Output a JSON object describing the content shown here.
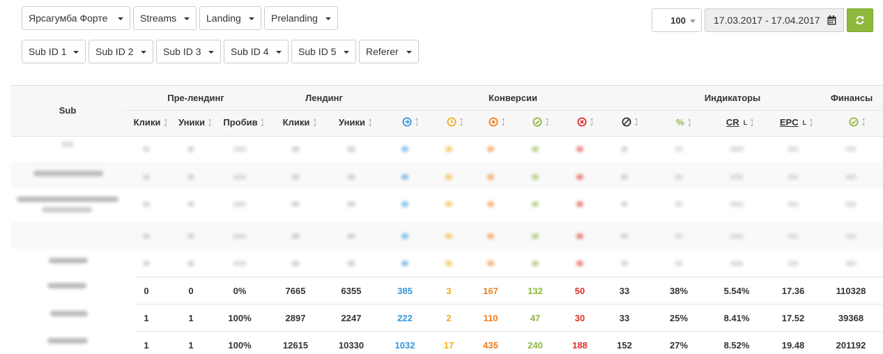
{
  "filters": {
    "row1": [
      "Ярсагумба Форте",
      "Streams",
      "Landing",
      "Prelanding"
    ],
    "row2": [
      "Sub ID 1",
      "Sub ID 2",
      "Sub ID 3",
      "Sub ID 4",
      "Sub ID 5",
      "Referer"
    ]
  },
  "toolbar": {
    "per_page": "100",
    "date_range": "17.03.2017 - 17.04.2017"
  },
  "colors": {
    "accent_green": "#8cb83b",
    "blue": "#3498db",
    "yellow": "#f0ad1e",
    "orange": "#f07f1e",
    "green": "#8cb83b",
    "red": "#e0302a",
    "dark": "#333333"
  },
  "table": {
    "groups": {
      "sub": "Sub",
      "prelanding": "Пре-лендинг",
      "landing": "Лендинг",
      "conversions": "Конверсии",
      "indicators": "Индикаторы",
      "finance": "Финансы"
    },
    "columns": {
      "pre_clicks": "Клики",
      "pre_uniques": "Уники",
      "breakthrough": "Пробив",
      "land_clicks": "Клики",
      "land_uniques": "Уники",
      "pct": "%",
      "cr": "CR",
      "epc": "EPC",
      "sup": "L"
    },
    "icons": [
      "conv-total-icon",
      "conv-hold-icon",
      "conv-pending-icon",
      "conv-approved-icon",
      "conv-rejected-icon",
      "conv-trash-icon",
      "finance-approved-icon"
    ],
    "rows": [
      {
        "pre_clicks": "0",
        "pre_uniques": "0",
        "breakthrough": "0%",
        "land_clicks": "7665",
        "land_uniques": "6355",
        "c_total": "385",
        "c_hold": "3",
        "c_pending": "167",
        "c_approved": "132",
        "c_rejected": "50",
        "c_trash": "33",
        "pct": "38%",
        "cr": "5.54%",
        "epc": "17.36",
        "finance": "110328"
      },
      {
        "pre_clicks": "1",
        "pre_uniques": "1",
        "breakthrough": "100%",
        "land_clicks": "2897",
        "land_uniques": "2247",
        "c_total": "222",
        "c_hold": "2",
        "c_pending": "110",
        "c_approved": "47",
        "c_rejected": "30",
        "c_trash": "33",
        "pct": "25%",
        "cr": "8.41%",
        "epc": "17.52",
        "finance": "39368"
      },
      {
        "pre_clicks": "1",
        "pre_uniques": "1",
        "breakthrough": "100%",
        "land_clicks": "12615",
        "land_uniques": "10330",
        "c_total": "1032",
        "c_hold": "17",
        "c_pending": "435",
        "c_approved": "240",
        "c_rejected": "188",
        "c_trash": "152",
        "pct": "27%",
        "cr": "8.52%",
        "epc": "19.48",
        "finance": "201192"
      }
    ]
  }
}
